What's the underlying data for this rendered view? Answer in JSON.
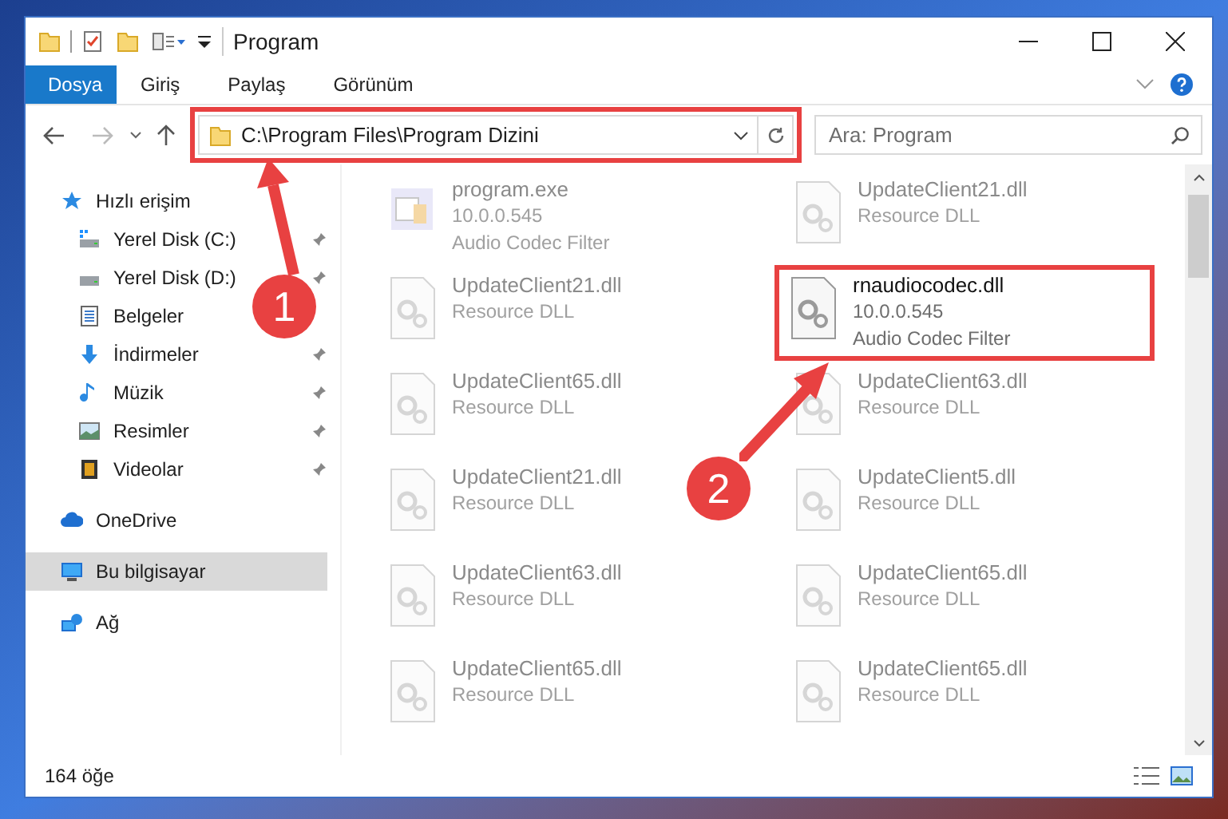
{
  "window": {
    "title": "Program"
  },
  "ribbon_tabs": [
    {
      "label": "Dosya",
      "selected": true
    },
    {
      "label": "Giriş",
      "selected": false
    },
    {
      "label": "Paylaş",
      "selected": false
    },
    {
      "label": "Görünüm",
      "selected": false
    }
  ],
  "address_bar": {
    "path": "C:\\Program Files\\Program Dizini",
    "highlighted": true
  },
  "search": {
    "placeholder": "Ara: Program"
  },
  "nav": [
    {
      "label": "Hızlı erişim",
      "kind": "star",
      "selected": false,
      "children": [
        {
          "label": "Yerel Disk (C:)",
          "kind": "drive-c",
          "pinned": true,
          "selected": false
        },
        {
          "label": "Yerel Disk (D:)",
          "kind": "drive",
          "pinned": true,
          "selected": false
        },
        {
          "label": "Belgeler",
          "kind": "docs",
          "pinned": false,
          "selected": false
        },
        {
          "label": "İndirmeler",
          "kind": "download",
          "pinned": true,
          "selected": false
        },
        {
          "label": "Müzik",
          "kind": "music",
          "pinned": true,
          "selected": false
        },
        {
          "label": "Resimler",
          "kind": "pictures",
          "pinned": true,
          "selected": false
        },
        {
          "label": "Videolar",
          "kind": "video",
          "pinned": true,
          "selected": false
        }
      ]
    },
    {
      "label": "OneDrive",
      "kind": "cloud",
      "selected": false
    },
    {
      "label": "Bu bilgisayar",
      "kind": "pc",
      "selected": true
    },
    {
      "label": "Ağ",
      "kind": "network",
      "selected": false
    }
  ],
  "files": [
    {
      "kind": "exe",
      "name": "program.exe",
      "lines": [
        "10.0.0.545",
        "Audio Codec Filter"
      ],
      "blurred": true,
      "highlighted": false
    },
    {
      "kind": "dll",
      "name": "UpdateClient21.dll",
      "lines": [
        "Resource DLL"
      ],
      "blurred": true,
      "highlighted": false
    },
    {
      "kind": "dll",
      "name": "UpdateClient21.dll",
      "lines": [
        "Resource DLL"
      ],
      "blurred": true,
      "highlighted": false
    },
    {
      "kind": "dll",
      "name": "rnaudiocodec.dll",
      "lines": [
        "10.0.0.545",
        "Audio Codec Filter"
      ],
      "blurred": false,
      "highlighted": true
    },
    {
      "kind": "dll",
      "name": "UpdateClient65.dll",
      "lines": [
        "Resource DLL"
      ],
      "blurred": true,
      "highlighted": false
    },
    {
      "kind": "dll",
      "name": "UpdateClient63.dll",
      "lines": [
        "Resource DLL"
      ],
      "blurred": true,
      "highlighted": false
    },
    {
      "kind": "dll",
      "name": "UpdateClient21.dll",
      "lines": [
        "Resource DLL"
      ],
      "blurred": true,
      "highlighted": false
    },
    {
      "kind": "dll",
      "name": "UpdateClient5.dll",
      "lines": [
        "Resource DLL"
      ],
      "blurred": true,
      "highlighted": false
    },
    {
      "kind": "dll",
      "name": "UpdateClient63.dll",
      "lines": [
        "Resource DLL"
      ],
      "blurred": true,
      "highlighted": false
    },
    {
      "kind": "dll",
      "name": "UpdateClient65.dll",
      "lines": [
        "Resource DLL"
      ],
      "blurred": true,
      "highlighted": false
    },
    {
      "kind": "dll",
      "name": "UpdateClient65.dll",
      "lines": [
        "Resource DLL"
      ],
      "blurred": true,
      "highlighted": false
    },
    {
      "kind": "dll",
      "name": "UpdateClient65.dll",
      "lines": [
        "Resource DLL"
      ],
      "blurred": true,
      "highlighted": false
    }
  ],
  "status_bar": {
    "item_count": "164 öğe"
  },
  "annotations": [
    {
      "label": "1"
    },
    {
      "label": "2"
    }
  ]
}
